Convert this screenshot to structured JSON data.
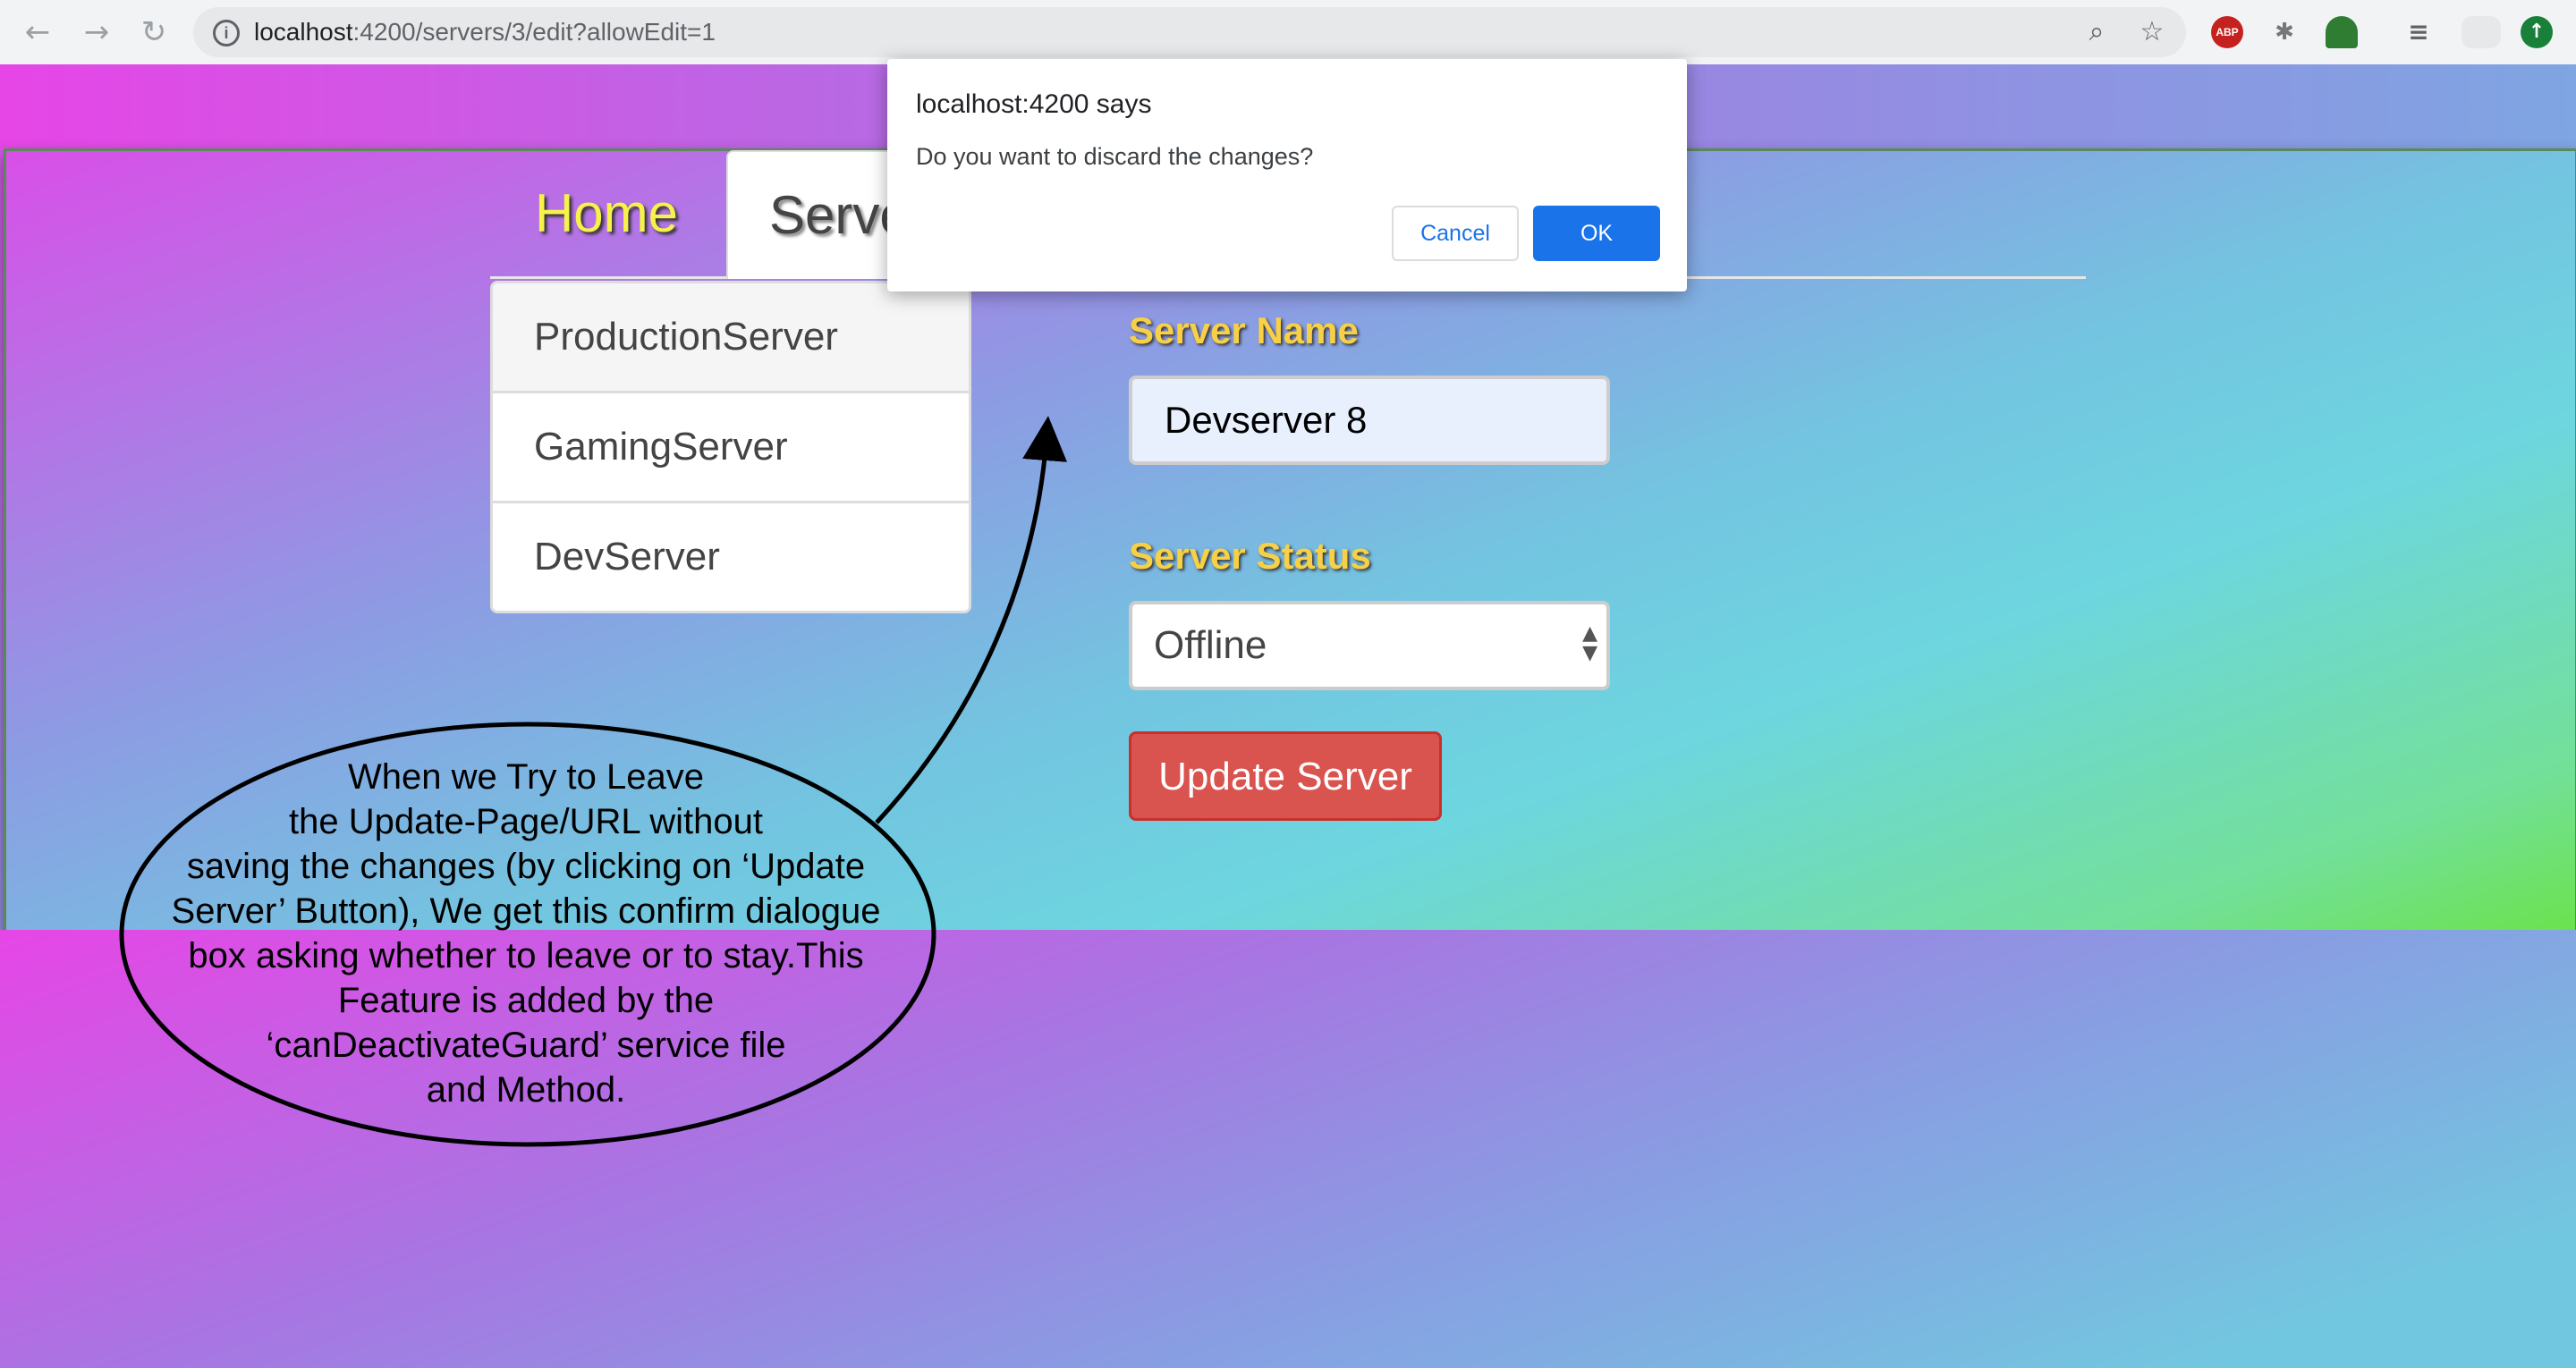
{
  "browser": {
    "url_host": "localhost",
    "url_rest": ":4200/servers/3/edit?allowEdit=1",
    "icons": {
      "back": "back-arrow-icon",
      "forward": "forward-arrow-icon",
      "reload": "reload-icon",
      "info": "info-icon",
      "zoom": "zoom-icon",
      "bookmark": "star-icon"
    },
    "extensions": [
      "ABP",
      "bug",
      "HTML",
      "queue",
      "cloud",
      "update"
    ],
    "abp_label": "ABP"
  },
  "nav": {
    "tabs": [
      {
        "label": "Home"
      },
      {
        "label": "Servers"
      }
    ]
  },
  "servers": {
    "items": [
      {
        "label": "ProductionServer"
      },
      {
        "label": "GamingServer"
      },
      {
        "label": "DevServer"
      }
    ]
  },
  "form": {
    "name_label": "Server Name",
    "name_value": "Devserver 8",
    "status_label": "Server Status",
    "status_value": "Offline",
    "update_button": "Update Server"
  },
  "dialog": {
    "title": "localhost:4200 says",
    "message": "Do you want to discard the changes?",
    "cancel_label": "Cancel",
    "ok_label": "OK"
  },
  "annotation": {
    "lines": [
      "When we Try to Leave",
      "the Update-Page/URL without",
      "saving the changes (by clicking on ‘Update",
      "Server’ Button), We get this confirm dialogue",
      "box asking whether to leave or to stay.This",
      "Feature is added by the",
      "‘canDeactivateGuard’ service file",
      "and Method."
    ]
  },
  "colors": {
    "link_blue": "#1a73e8",
    "danger": "#d9534f",
    "label_yellow": "#f7d046",
    "home_yellow": "#f7f24a"
  }
}
